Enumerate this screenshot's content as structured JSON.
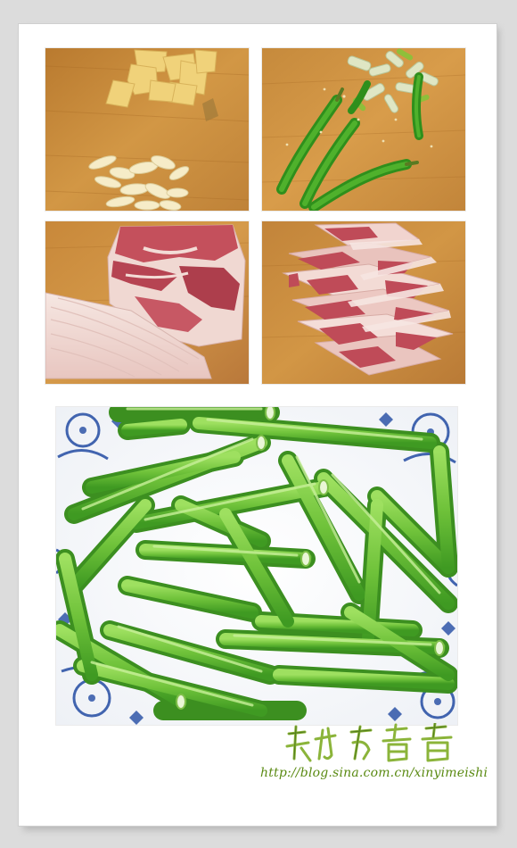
{
  "photos": [
    {
      "subject": "sliced ginger and garlic on cutting board"
    },
    {
      "subject": "green chili peppers and chopped scallion"
    },
    {
      "subject": "slab of pork belly and a strip of fat"
    },
    {
      "subject": "thinly sliced pork belly pieces"
    },
    {
      "subject": "plate of cut long green peppers"
    }
  ],
  "watermark": {
    "signature": "馨怡友香香",
    "url": "http://blog.sina.com.cn/xinyimeishi"
  },
  "colors": {
    "board": "#c98d3a",
    "pepper": "#6fc23a",
    "pork_lean": "#c0505c",
    "pork_fat": "#f3dcd6",
    "url_text": "#5a8a12"
  }
}
